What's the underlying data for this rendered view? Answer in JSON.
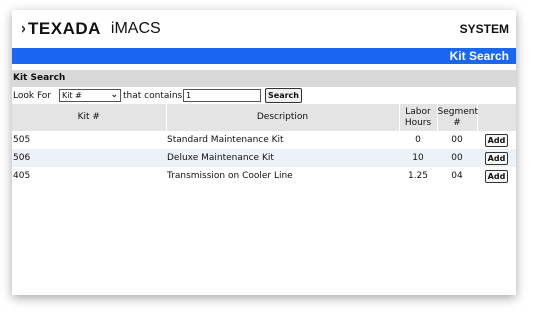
{
  "header": {
    "logo_mark": "›",
    "logo_text": "TEXADA",
    "app_name": "iMACS",
    "system_label": "SYSTEM"
  },
  "page_title": "Kit Search",
  "section_title": "Kit Search",
  "search": {
    "look_for_label": "Look For",
    "select_value": "Kit #",
    "contains_label": "that contains",
    "input_value": "1",
    "button_label": "Search"
  },
  "table": {
    "columns": [
      "Kit #",
      "Description",
      "Labor\nHours",
      "Segment\n#"
    ],
    "rows": [
      {
        "kit": "505",
        "description": "Standard Maintenance Kit",
        "labor": "0",
        "segment": "00",
        "action": "Add"
      },
      {
        "kit": "506",
        "description": "Deluxe Maintenance Kit",
        "labor": "10",
        "segment": "00",
        "action": "Add"
      },
      {
        "kit": "405",
        "description": "Transmission on Cooler Line",
        "labor": "1.25",
        "segment": "04",
        "action": "Add"
      }
    ]
  }
}
